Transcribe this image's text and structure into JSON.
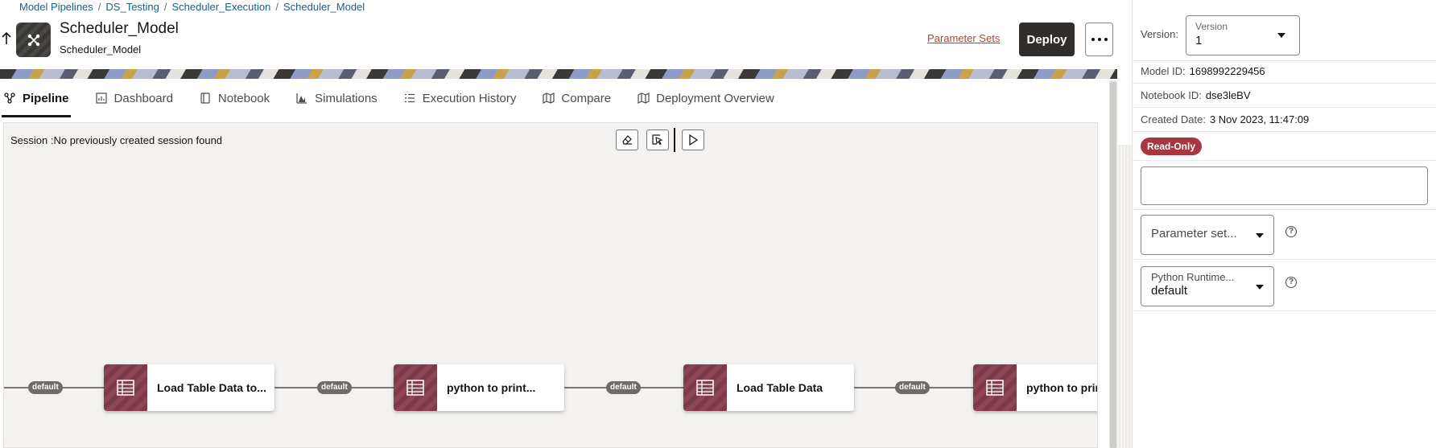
{
  "breadcrumb": [
    "Model Pipelines",
    "DS_Testing",
    "Scheduler_Execution",
    "Scheduler_Model"
  ],
  "header": {
    "title": "Scheduler_Model",
    "subtitle": "Scheduler_Model",
    "parameter_sets_link": "Parameter Sets",
    "deploy_label": "Deploy"
  },
  "tabs": [
    {
      "label": "Pipeline",
      "icon": "pipeline-icon",
      "active": true
    },
    {
      "label": "Dashboard",
      "icon": "dashboard-icon",
      "active": false
    },
    {
      "label": "Notebook",
      "icon": "notebook-icon",
      "active": false
    },
    {
      "label": "Simulations",
      "icon": "simulations-icon",
      "active": false
    },
    {
      "label": "Execution History",
      "icon": "list-icon",
      "active": false
    },
    {
      "label": "Compare",
      "icon": "map-icon",
      "active": false
    },
    {
      "label": "Deployment Overview",
      "icon": "map-icon",
      "active": false
    }
  ],
  "canvas": {
    "session_text": "Session :No previously created session found",
    "nodes": [
      {
        "label": "Load Table Data to...",
        "icon": "table-icon"
      },
      {
        "label": "python to print...",
        "icon": "table-icon"
      },
      {
        "label": "Load Table Data",
        "icon": "table-icon"
      },
      {
        "label": "python to print",
        "icon": "table-icon"
      }
    ],
    "edges": [
      {
        "label": "default"
      },
      {
        "label": "default"
      },
      {
        "label": "default"
      },
      {
        "label": "default"
      }
    ]
  },
  "panel": {
    "version_label": "Version:",
    "version_select_label": "Version",
    "version_value": "1",
    "model_id_label": "Model ID:",
    "model_id": "1698992229456",
    "notebook_id_label": "Notebook ID:",
    "notebook_id": "dse3leBV",
    "created_date_label": "Created Date:",
    "created_date": "3 Nov 2023, 11:47:09",
    "status_badge": "Read-Only",
    "text_input_value": "",
    "parameter_set_placeholder": "Parameter set...",
    "python_runtime_label": "Python Runtime...",
    "python_runtime_value": "default"
  },
  "colors": {
    "accent_dark": "#312d2a",
    "link": "#1f5e84",
    "link_alt": "#b0423a",
    "badge": "#a8363f",
    "node_icon": "#7d3a4a",
    "canvas_bg": "#f3f2f0"
  }
}
